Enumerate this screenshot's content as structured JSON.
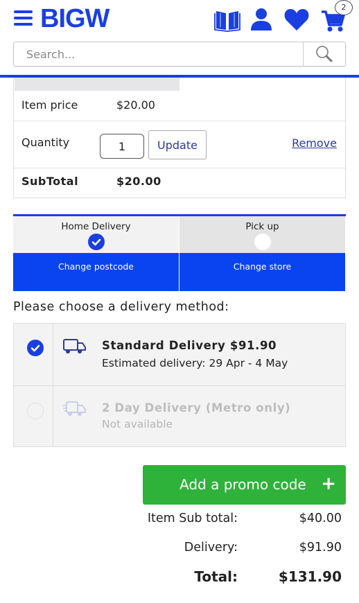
{
  "header": {
    "logo": "BIGW",
    "icons": [
      "catalogue-icon",
      "account-icon",
      "wishlist-icon",
      "cart-icon"
    ],
    "cart_count": "2",
    "brand_color": "#1a3fe0"
  },
  "search": {
    "placeholder": "Search...",
    "value": ""
  },
  "item": {
    "price_label": "Item price",
    "price_value": "$20.00",
    "quantity_label": "Quantity",
    "quantity_value": "1",
    "update_label": "Update",
    "remove_label": "Remove",
    "subtotal_label": "SubTotal",
    "subtotal_value": "$20.00"
  },
  "fulfilment": {
    "tabs": [
      {
        "label": "Home Delivery",
        "selected": true,
        "action": "Change postcode"
      },
      {
        "label": "Pick up",
        "selected": false,
        "action": "Change store"
      }
    ]
  },
  "delivery": {
    "prompt": "Please choose a delivery method:",
    "methods": [
      {
        "title": "Standard Delivery  $91.90",
        "subtitle": "Estimated delivery: 29 Apr - 4 May",
        "selected": true,
        "available": true
      },
      {
        "title": "2 Day Delivery (Metro only)",
        "subtitle": "Not available",
        "selected": false,
        "available": false
      }
    ]
  },
  "promo": {
    "label": "Add a promo code",
    "icon": "+",
    "color": "#2eb23a"
  },
  "totals": {
    "item_sub_total_label": "Item Sub total:",
    "item_sub_total_value": "$40.00",
    "delivery_label": "Delivery:",
    "delivery_value": "$91.90",
    "total_label": "Total:",
    "total_value": "$131.90"
  }
}
